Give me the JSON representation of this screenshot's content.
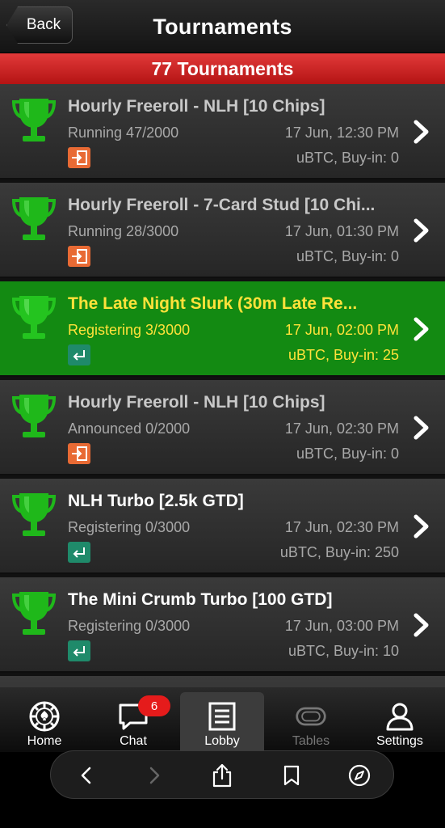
{
  "header": {
    "back_label": "Back",
    "title": "Tournaments"
  },
  "count_label": "77 Tournaments",
  "tournaments": [
    {
      "name": "Hourly Freeroll - NLH [10 Chips]",
      "status": "Running 47/2000",
      "date": "17 Jun, 12:30 PM",
      "buyin": "uBTC, Buy-in: 0",
      "badge": "late-register-icon"
    },
    {
      "name": "Hourly Freeroll - 7-Card Stud [10 Chi...",
      "status": "Running 28/3000",
      "date": "17 Jun, 01:30 PM",
      "buyin": "uBTC, Buy-in: 0",
      "badge": "late-register-icon"
    },
    {
      "name": "The Late Night Slurk (30m Late Re...",
      "status": "Registering 3/3000",
      "date": "17 Jun, 02:00 PM",
      "buyin": "uBTC, Buy-in: 25",
      "badge": "register-icon"
    },
    {
      "name": "Hourly Freeroll - NLH [10 Chips]",
      "status": "Announced 0/2000",
      "date": "17 Jun, 02:30 PM",
      "buyin": "uBTC, Buy-in: 0",
      "badge": "late-register-icon"
    },
    {
      "name": "NLH Turbo [2.5k GTD]",
      "status": "Registering 0/3000",
      "date": "17 Jun, 02:30 PM",
      "buyin": "uBTC, Buy-in: 250",
      "badge": "register-icon"
    },
    {
      "name": "The Mini Crumb Turbo [100 GTD]",
      "status": "Registering 0/3000",
      "date": "17 Jun, 03:00 PM",
      "buyin": "uBTC, Buy-in: 10",
      "badge": "register-icon"
    }
  ],
  "tabs": [
    {
      "label": "Home",
      "icon": "poker-chip-icon"
    },
    {
      "label": "Chat",
      "icon": "chat-bubble-icon",
      "badge": "6"
    },
    {
      "label": "Lobby",
      "icon": "list-icon",
      "active": true
    },
    {
      "label": "Tables",
      "icon": "tables-icon",
      "disabled": true
    },
    {
      "label": "Settings",
      "icon": "user-icon"
    }
  ],
  "colors": {
    "count_bar": "#d42a2a",
    "highlight_row": "#138a12",
    "highlight_text": "#ffe23a",
    "trophy": "#1fb81a",
    "chat_badge": "#e51b1b"
  }
}
